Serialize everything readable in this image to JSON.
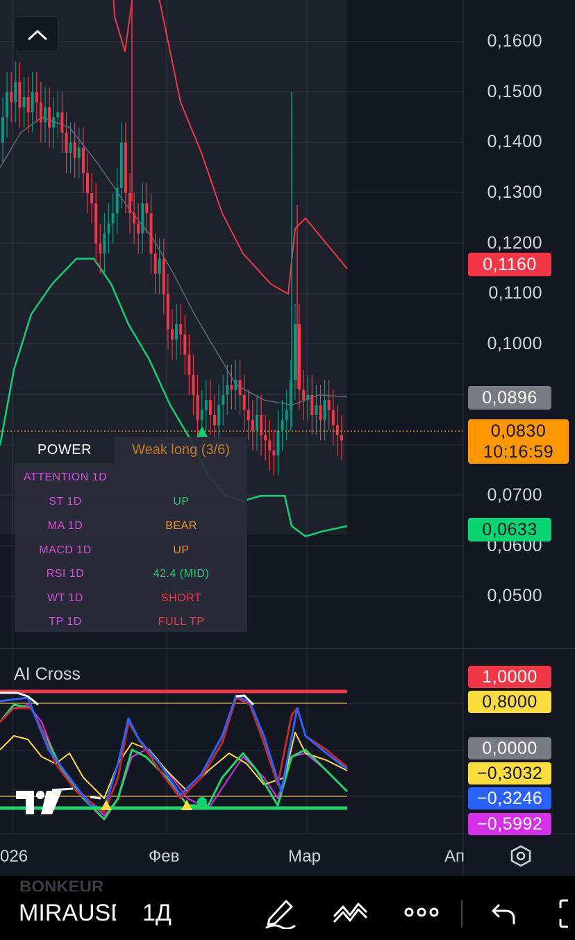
{
  "symbol": "MIRAUSDT",
  "timeframe": "1Д",
  "ghost_symbol": "BONKEUR",
  "price_axis_labels": [
    "0,1600",
    "0,1500",
    "0,1400",
    "0,1300",
    "0,1200",
    "0,1100",
    "0,1000",
    "0,0700",
    "0,0600",
    "0,0500"
  ],
  "tags": {
    "upper_band": {
      "text": "0,1160",
      "color": "#f23645"
    },
    "basis": {
      "text": "0,0896",
      "color": "#787b86"
    },
    "last_price": {
      "text": "0,0830",
      "countdown": "10:16:59",
      "color": "#ff9800"
    },
    "lower_band": {
      "text": "0,0633",
      "color": "#08d471"
    }
  },
  "power_table": {
    "header_left": "POWER",
    "header_right": "Weak long (3/6)",
    "header_right_color": "#c17a2c",
    "attention": "ATTENTION 1D",
    "rows": [
      {
        "label": "ST 1D",
        "value": "UP",
        "color": "#26c97a"
      },
      {
        "label": "MA 1D",
        "value": "BEAR",
        "color": "#f19322"
      },
      {
        "label": "MACD 1D",
        "value": "UP",
        "color": "#f19322"
      },
      {
        "label": "RSI 1D",
        "value": "42.4 (MID)",
        "color": "#26c97a"
      },
      {
        "label": "WT 1D",
        "value": "SHORT",
        "color": "#f23645"
      },
      {
        "label": "TP 1D",
        "value": "FULL TP",
        "color": "#f23645"
      }
    ]
  },
  "indicator": {
    "title": "AI Cross",
    "tags": [
      {
        "text": "1,0000",
        "color": "#f23645",
        "fg": "#ffffff"
      },
      {
        "text": "0,8000",
        "color": "#fddc3d",
        "fg": "#131722"
      },
      {
        "text": "0,0000",
        "color": "#787b86",
        "fg": "#ffffff"
      },
      {
        "text": "−0,3032",
        "color": "#fddc3d",
        "fg": "#131722"
      },
      {
        "text": "−0,3246",
        "color": "#2962ff",
        "fg": "#ffffff"
      },
      {
        "text": "−0,5992",
        "color": "#d62fe8",
        "fg": "#ffffff"
      }
    ]
  },
  "time_axis": [
    "026",
    "Фев",
    "Мар",
    "Ап"
  ],
  "icons": [
    "chevron-up-icon",
    "settings-hexagon-icon",
    "pencil-icon",
    "indicators-icon",
    "more-icon",
    "undo-icon",
    "fullscreen-icon",
    "tradingview-logo-icon"
  ]
}
